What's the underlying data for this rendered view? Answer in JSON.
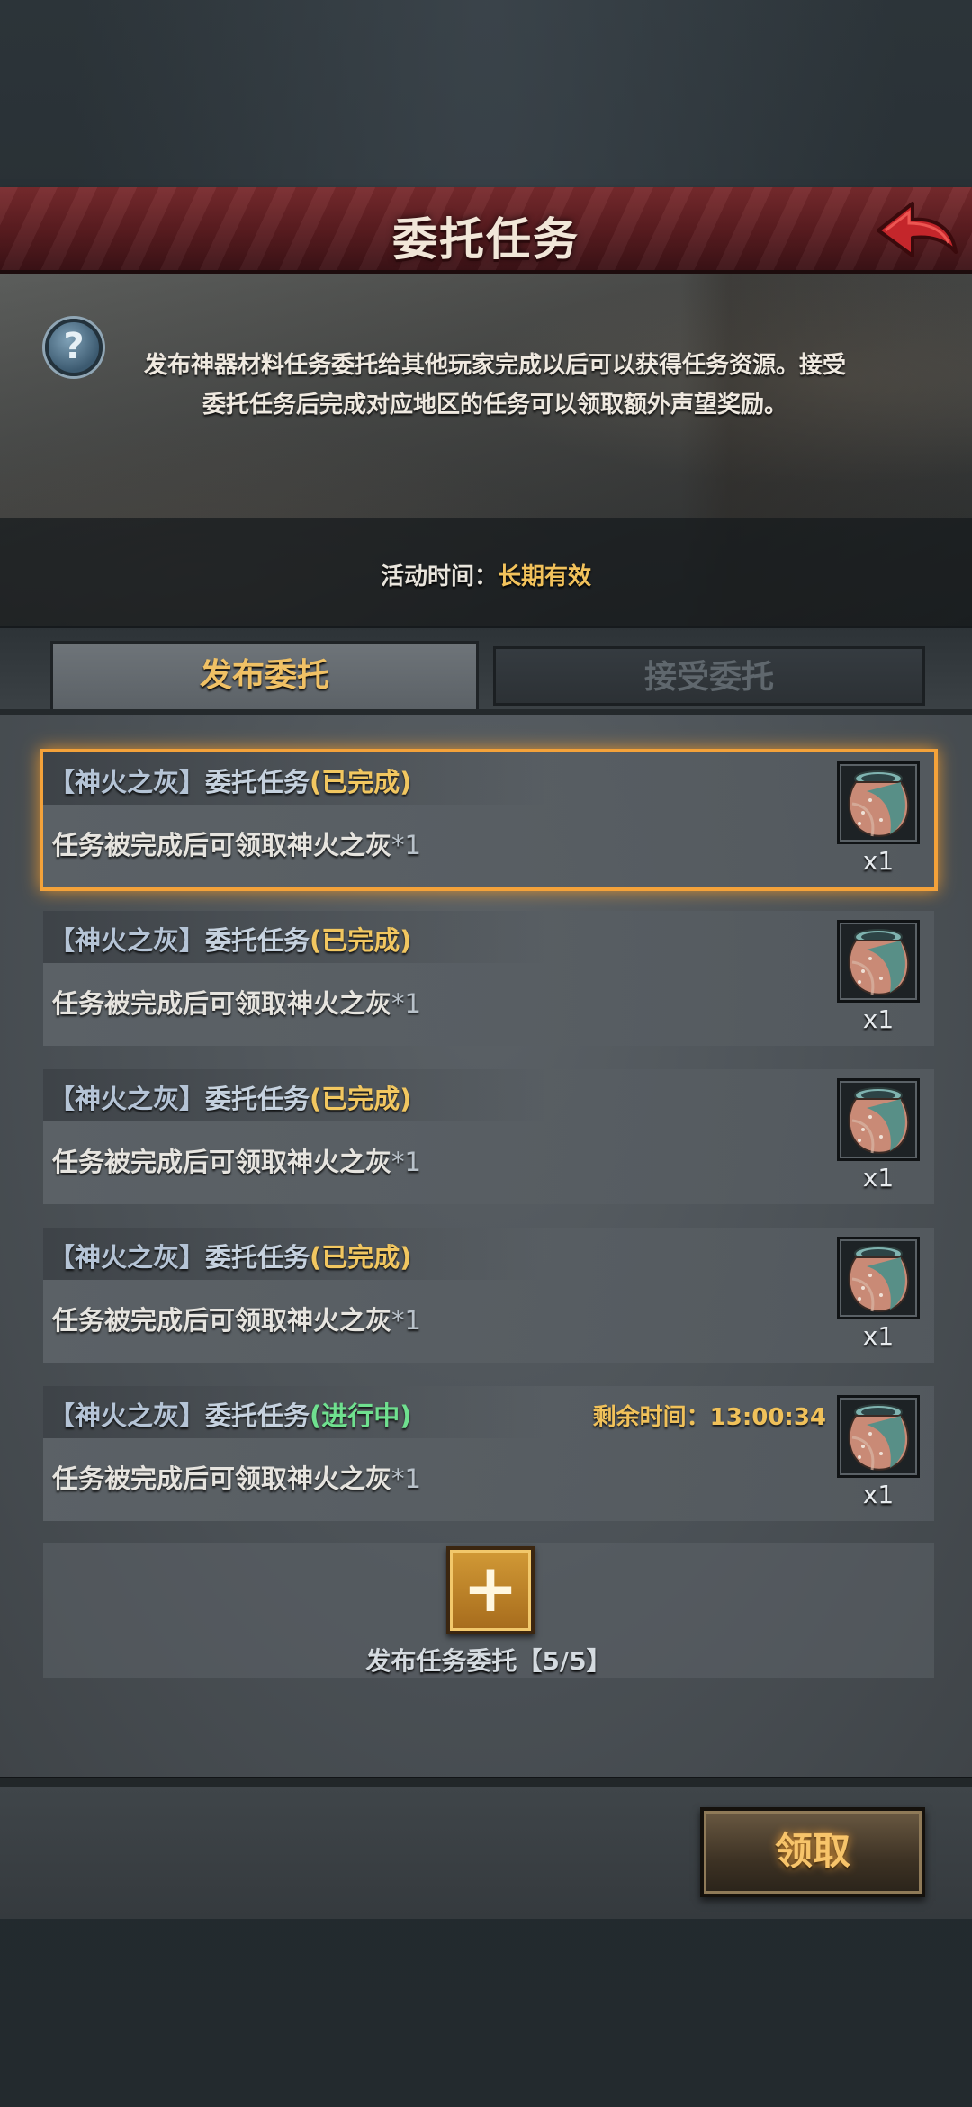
{
  "header": {
    "title": "委托任务",
    "back_icon": "back-arrow-icon"
  },
  "info": {
    "help_icon": "question-mark-icon",
    "help_glyph": "?",
    "description_line1": "发布神器材料任务委托给其他玩家完成以后可以获得任务资源。接受",
    "description_line2": "委托任务后完成对应地区的任务可以领取额外声望奖励。",
    "time_label": "活动时间：",
    "time_value": "长期有效"
  },
  "tabs": {
    "publish": "发布委托",
    "accept": "接受委托",
    "active": "publish"
  },
  "tasks": [
    {
      "bracket": "【神火之灰】",
      "name": "委托任务",
      "status": "(已完成)",
      "status_type": "done",
      "remaining": "",
      "desc": "任务被完成后可领取神火之灰",
      "qty": "*1",
      "reward_icon": "clay-pot-icon",
      "reward_count": "x1",
      "selected": true
    },
    {
      "bracket": "【神火之灰】",
      "name": "委托任务",
      "status": "(已完成)",
      "status_type": "done",
      "remaining": "",
      "desc": "任务被完成后可领取神火之灰",
      "qty": "*1",
      "reward_icon": "clay-pot-icon",
      "reward_count": "x1",
      "selected": false
    },
    {
      "bracket": "【神火之灰】",
      "name": "委托任务",
      "status": "(已完成)",
      "status_type": "done",
      "remaining": "",
      "desc": "任务被完成后可领取神火之灰",
      "qty": "*1",
      "reward_icon": "clay-pot-icon",
      "reward_count": "x1",
      "selected": false
    },
    {
      "bracket": "【神火之灰】",
      "name": "委托任务",
      "status": "(已完成)",
      "status_type": "done",
      "remaining": "",
      "desc": "任务被完成后可领取神火之灰",
      "qty": "*1",
      "reward_icon": "clay-pot-icon",
      "reward_count": "x1",
      "selected": false
    },
    {
      "bracket": "【神火之灰】",
      "name": "委托任务",
      "status": "(进行中)",
      "status_type": "progress",
      "remaining": "剩余时间：13:00:34",
      "desc": "任务被完成后可领取神火之灰",
      "qty": "*1",
      "reward_icon": "clay-pot-icon",
      "reward_count": "x1",
      "selected": false
    }
  ],
  "add": {
    "icon": "plus-icon",
    "glyph": "+",
    "label": "发布任务委托【5/5】"
  },
  "footer": {
    "claim_label": "领取"
  },
  "colors": {
    "accent_gold": "#f2c25b",
    "status_done": "#f2c760",
    "status_progress": "#6fe08f",
    "banner_red": "#7a2b2e",
    "selection_orange": "#f4a23a"
  }
}
